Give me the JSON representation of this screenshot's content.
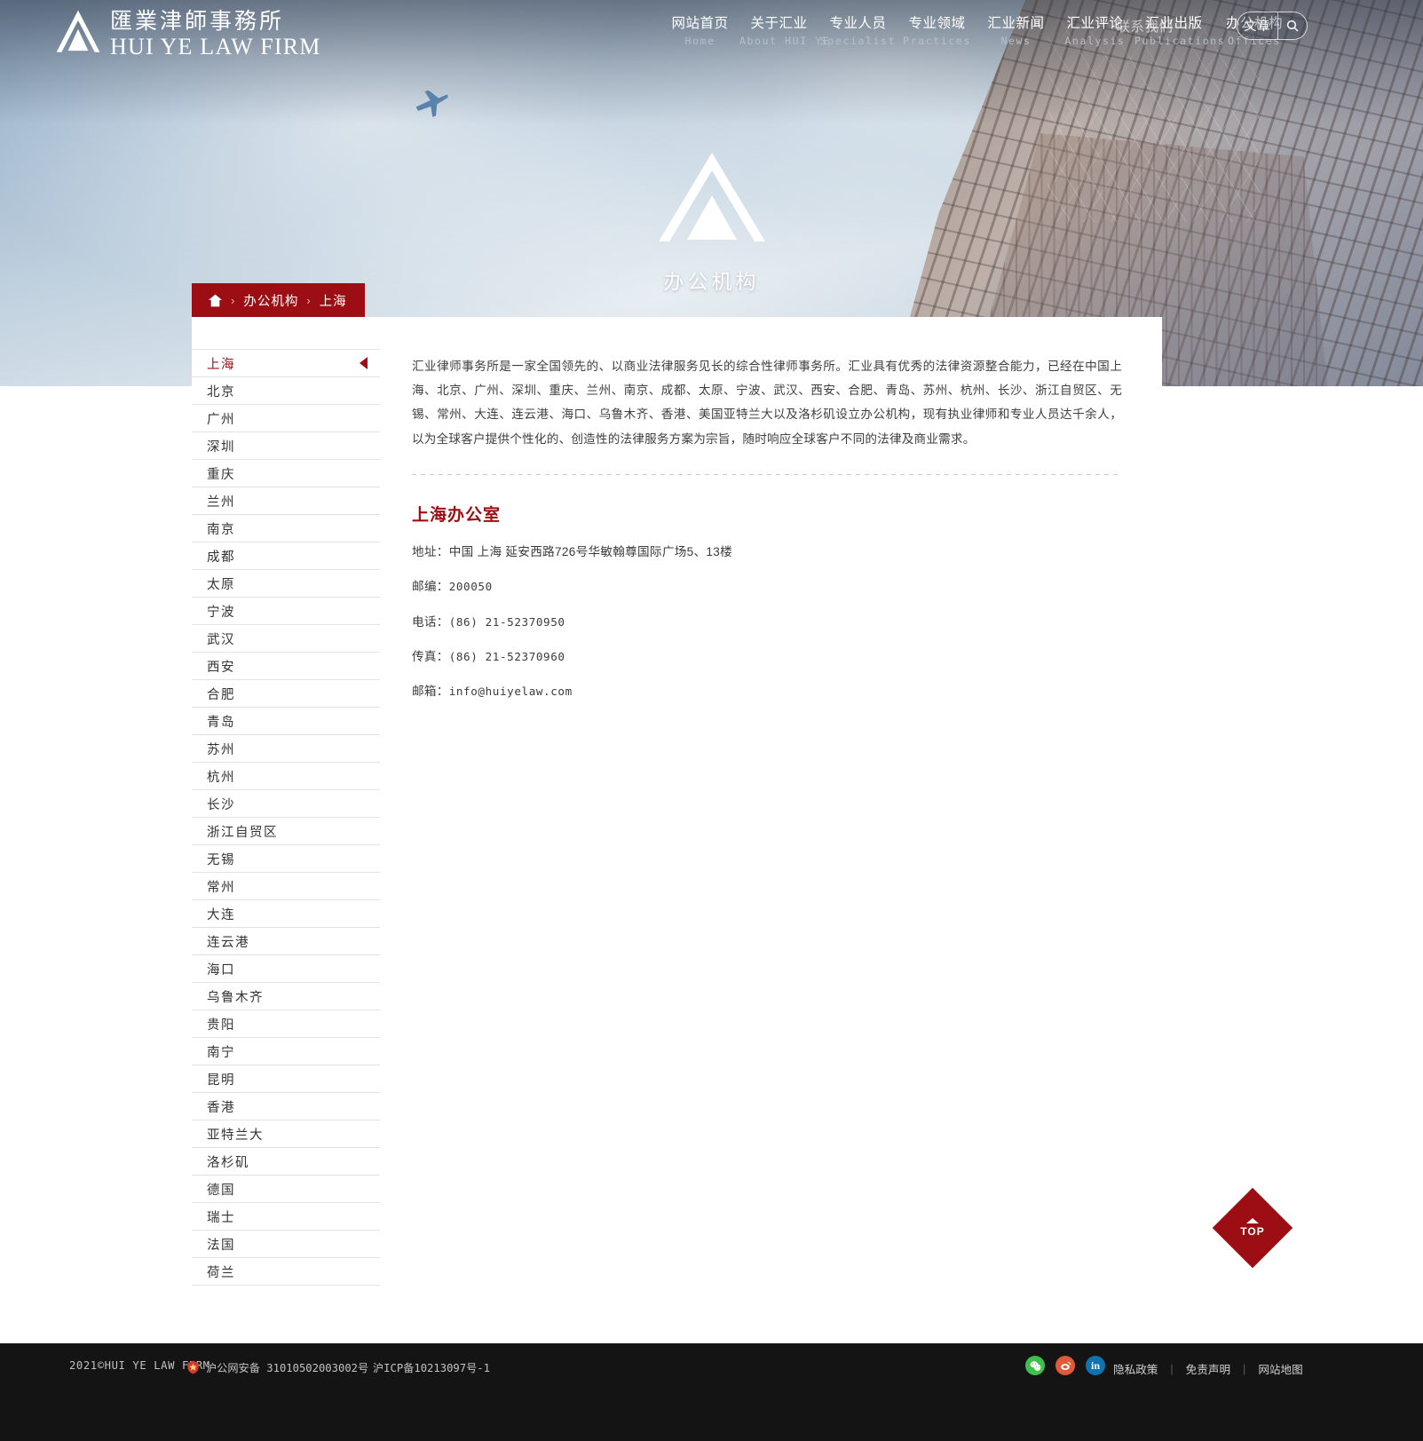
{
  "header": {
    "logo": {
      "cn": "匯業津師事務所",
      "en": "HUI YE LAW FIRM",
      "icon": "triangle-a-logo"
    },
    "nav": [
      {
        "cn": "网站首页",
        "en": "Home"
      },
      {
        "cn": "关于汇业",
        "en": "About HUI YE"
      },
      {
        "cn": "专业人员",
        "en": "Specialist"
      },
      {
        "cn": "专业领域",
        "en": "Practices"
      },
      {
        "cn": "汇业新闻",
        "en": "News"
      },
      {
        "cn": "汇业评论",
        "en": "Analysis"
      },
      {
        "cn": "汇业出版",
        "en": "Publications"
      },
      {
        "cn": "办公机构",
        "en": "Offices"
      }
    ],
    "contact": {
      "cn": "联系我们",
      "en": ""
    },
    "search": {
      "label": "文章",
      "icon": "search-icon"
    }
  },
  "hero": {
    "title": "办公机构",
    "logo_icon": "triangle-a-logo",
    "plane_icon": "airplane-icon"
  },
  "breadcrumb": {
    "home_icon": "home-icon",
    "separator": "›",
    "items": [
      "办公机构",
      "上海"
    ]
  },
  "sidebar": {
    "active_index": 0,
    "arrow_icon": "caret-left-icon",
    "cities": [
      "上海",
      "北京",
      "广州",
      "深圳",
      "重庆",
      "兰州",
      "南京",
      "成都",
      "太原",
      "宁波",
      "武汉",
      "西安",
      "合肥",
      "青岛",
      "苏州",
      "杭州",
      "长沙",
      "浙江自贸区",
      "无锡",
      "常州",
      "大连",
      "连云港",
      "海口",
      "乌鲁木齐",
      "贵阳",
      "南宁",
      "昆明",
      "香港",
      "亚特兰大",
      "洛杉矶",
      "德国",
      "瑞士",
      "法国",
      "荷兰"
    ]
  },
  "main": {
    "intro": "汇业律师事务所是一家全国领先的、以商业法律服务见长的综合性律师事务所。汇业具有优秀的法律资源整合能力，已经在中国上海、北京、广州、深圳、重庆、兰州、南京、成都、太原、宁波、武汉、西安、合肥、青岛、苏州、杭州、长沙、浙江自贸区、无锡、常州、大连、连云港、海口、乌鲁木齐、香港、美国亚特兰大以及洛杉矶设立办公机构，现有执业律师和专业人员达千余人，以为全球客户提供个性化的、创造性的法律服务方案为宗旨，随时响应全球客户不同的法律及商业需求。",
    "office_title": "上海办公室",
    "details": [
      {
        "label": "地址：",
        "value": "中国 上海 延安西路726号华敏翰尊国际广场5、13楼"
      },
      {
        "label": "邮编：",
        "value": "200050"
      },
      {
        "label": "电话：",
        "value": "(86) 21-52370950"
      },
      {
        "label": "传真：",
        "value": "(86) 21-52370960"
      },
      {
        "label": "邮箱：",
        "value": "info@huiyelaw.com"
      }
    ]
  },
  "back_to_top": {
    "label": "TOP",
    "icon": "chevron-up-icon"
  },
  "footer": {
    "copyright": "2021©HUI YE LAW FIRM",
    "police_icon": "police-badge-icon",
    "police_record": "沪公网安备 31010502003002号",
    "icp": "沪ICP备10213097号-1",
    "social": [
      {
        "name": "wechat-icon",
        "glyph": "✉"
      },
      {
        "name": "weibo-icon",
        "glyph": "◉"
      },
      {
        "name": "linkedin-icon",
        "glyph": "in"
      }
    ],
    "links": [
      "隐私政策",
      "免责声明",
      "网站地图"
    ],
    "pipe": "|"
  },
  "colors": {
    "brand_red": "#9c0e13",
    "footer_bg": "#141414",
    "text": "#333333"
  }
}
